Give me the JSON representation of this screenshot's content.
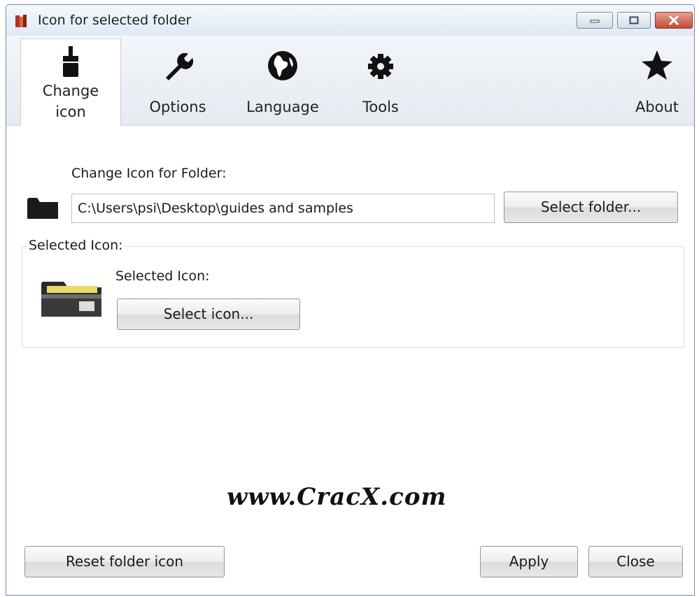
{
  "window": {
    "title": "Icon for selected folder"
  },
  "ribbon": {
    "tabs": [
      {
        "label_line1": "Change",
        "label_line2": "icon",
        "icon": "brush-icon",
        "active": true
      },
      {
        "label": "Options",
        "icon": "wrench-icon"
      },
      {
        "label": "Language",
        "icon": "globe-icon"
      },
      {
        "label": "Tools",
        "icon": "gear-icon"
      },
      {
        "label": "About",
        "icon": "star-icon"
      }
    ]
  },
  "folder_section": {
    "label": "Change Icon for Folder:",
    "path_value": "C:\\Users\\psi\\Desktop\\guides and samples",
    "select_folder_label": "Select folder..."
  },
  "icon_section": {
    "group_title": "Selected Icon:",
    "inner_label": "Selected Icon:",
    "select_icon_label": "Select icon..."
  },
  "watermark": "www.CracX.com",
  "footer": {
    "reset_label": "Reset folder icon",
    "apply_label": "Apply",
    "close_label": "Close"
  },
  "colors": {
    "titlebar": "#dfe9f6",
    "close_button": "#c24a35",
    "ribbon": "#e6ebf1"
  }
}
